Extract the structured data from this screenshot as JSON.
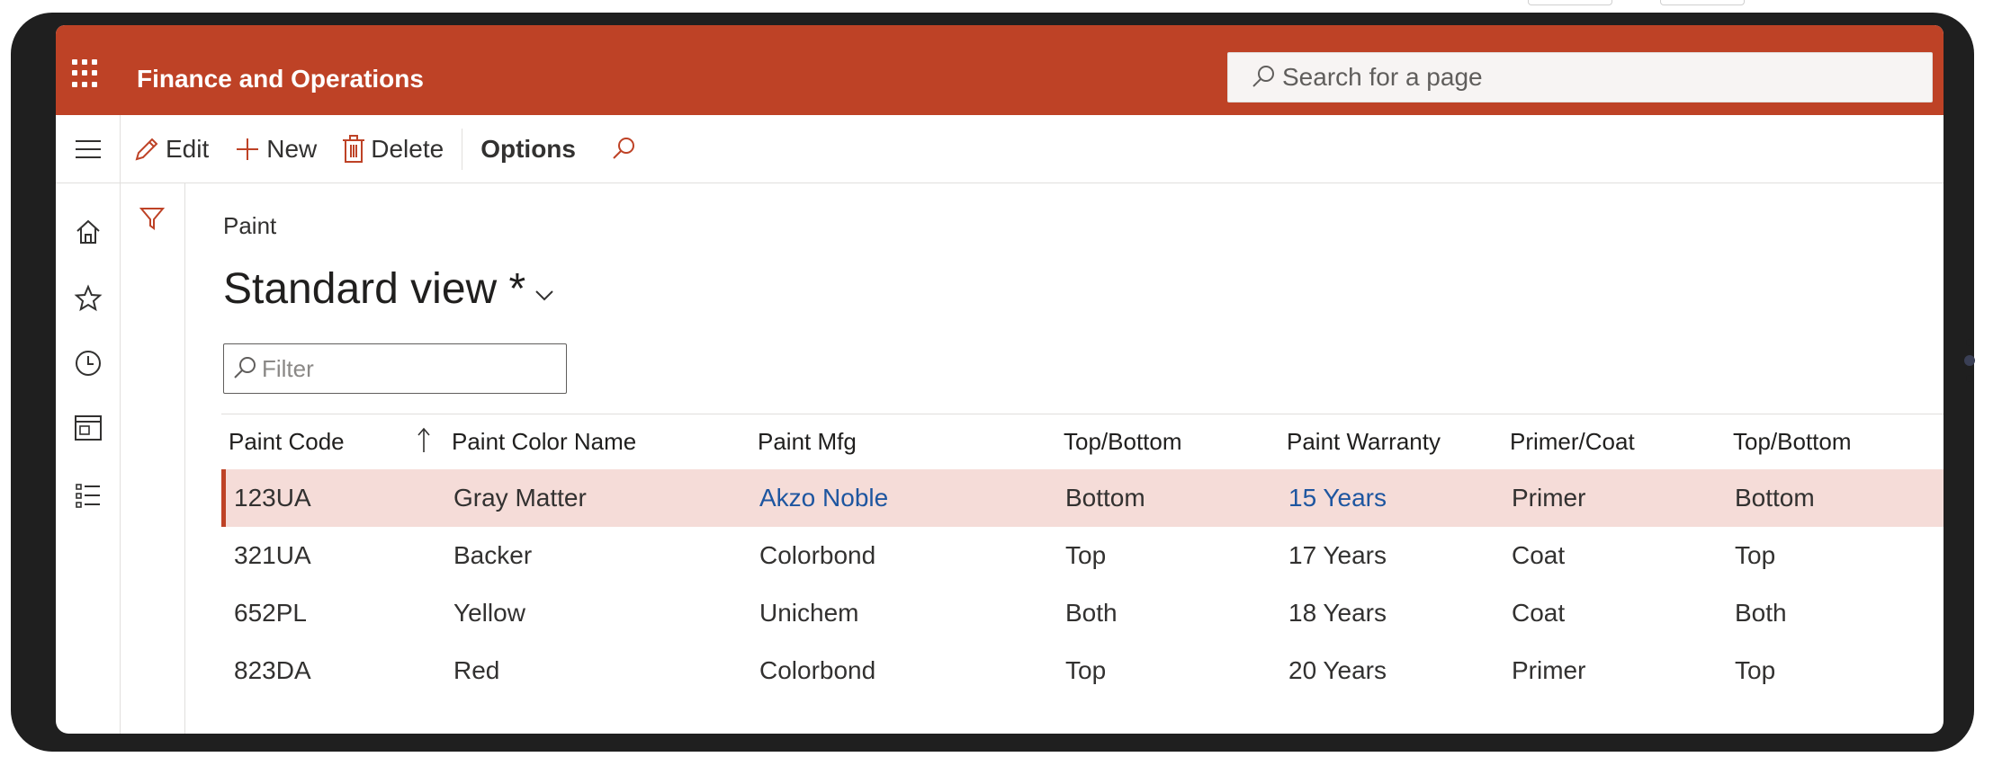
{
  "app": {
    "title": "Finance and Operations",
    "search_placeholder": "Search for a page",
    "brand_color": "#be4226"
  },
  "toolbar": {
    "edit_label": "Edit",
    "new_label": "New",
    "delete_label": "Delete",
    "options_label": "Options"
  },
  "page": {
    "breadcrumb": "Paint",
    "view_title": "Standard view *",
    "filter_placeholder": "Filter"
  },
  "grid": {
    "columns": [
      "Paint Code",
      "Paint Color Name",
      "Paint Mfg",
      "Top/Bottom",
      "Paint Warranty",
      "Primer/Coat",
      "Top/Bottom"
    ],
    "sorted_column": "Paint Code",
    "rows": [
      [
        "123UA",
        "Gray Matter",
        "Akzo Noble",
        "Bottom",
        "15 Years",
        "Primer",
        "Bottom"
      ],
      [
        "321UA",
        "Backer",
        "Colorbond",
        "Top",
        "17 Years",
        "Coat",
        "Top"
      ],
      [
        "652PL",
        "Yellow",
        "Unichem",
        "Both",
        "18 Years",
        "Coat",
        "Both"
      ],
      [
        "823DA",
        "Red",
        "Colorbond",
        "Top",
        "20 Years",
        "Primer",
        "Top"
      ]
    ],
    "selected_row": 0
  }
}
